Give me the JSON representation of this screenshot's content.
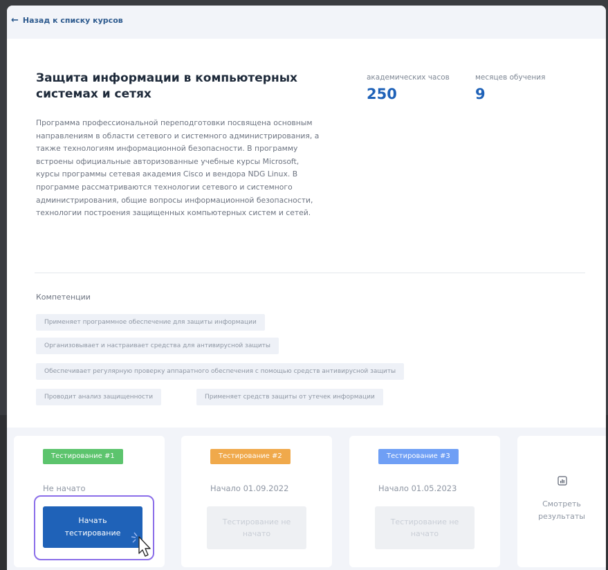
{
  "header": {
    "back_link": "Назад к списку курсов"
  },
  "course": {
    "title": "Защита информации в компьютерных системах и сетях",
    "stats": [
      {
        "label": "академических часов",
        "value": "250"
      },
      {
        "label": "месяцев обучения",
        "value": "9"
      }
    ],
    "description": "Программа профессиональной переподготовки посвящена основным направлениям в области сетевого и системного администрирования, а также технологиям информационной безопасности. В программу встроены официальные авторизованные учебные курсы Microsoft, курсы программы сетевая академия Cisco и вендора NDG Linux. В программе рассматриваются технологии сетевого и системного администрирования, общие вопросы информационной безопасности, технологии построения защищенных компьютерных систем и сетей.",
    "competencies_title": "Компетенции",
    "competencies": [
      "Применяет программное обеспечение для защиты информации",
      "Организовывает и настраивает средства для антивирусной защиты",
      "Обеспечивает регулярную проверку аппаратного обеспечения с помощью средств антивирусной защиты",
      "Проводит анализ защищенности",
      "Применяет средств защиты от утечек информации"
    ]
  },
  "tests": [
    {
      "badge": "Тестирование #1",
      "badge_color": "#5cc46d",
      "status": "Не начато",
      "button": "Начать тестирование",
      "enabled": true
    },
    {
      "badge": "Тестирование #2",
      "badge_color": "#f0a94b",
      "status": "Начало 01.09.2022",
      "button": "Тестирование не начато",
      "enabled": false
    },
    {
      "badge": "Тестирование #3",
      "badge_color": "#6f9ff5",
      "status": "Начало 01.05.2023",
      "button": "Тестирование не начато",
      "enabled": false
    }
  ],
  "results": {
    "icon": "bar-chart-icon",
    "label": "Смотреть результаты"
  },
  "colors": {
    "accent": "#1f62b8",
    "focus": "#8a6de9"
  }
}
